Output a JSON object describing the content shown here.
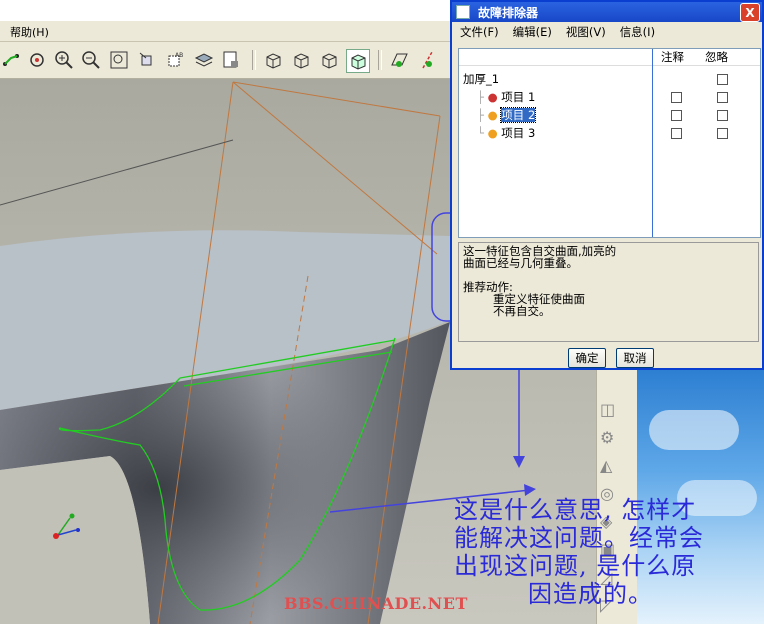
{
  "menubar": {
    "help_label": "帮助(H)"
  },
  "dialog": {
    "title": "故障排除器",
    "close_label": "X",
    "menu": [
      "文件(F)",
      "编辑(E)",
      "视图(V)",
      "信息(I)"
    ],
    "columns": {
      "note": "注释",
      "ignore": "忽略"
    },
    "tree": {
      "root": "加厚_1",
      "items": [
        "项目 1",
        "项目 2",
        "项目 3"
      ]
    },
    "message": {
      "line1": "这一特征包含自交曲面,加亮的",
      "line2": "曲面已经与几何重叠。",
      "action_title": "推荐动作:",
      "action_line1": "重定义特征使曲面",
      "action_line2": "不再自交。"
    },
    "ok_label": "确定",
    "cancel_label": "取消"
  },
  "annotation": {
    "line1": "这是什么意思, 怎样才",
    "line2": "能解决这问题。经常会",
    "line3": "出现这问题, 是什么原",
    "line4": "因造成的。"
  },
  "watermark": "BBS.CHINADE.NET",
  "colors": {
    "title_blue": "#1847c7",
    "annotation_blue": "#2a2ad8",
    "sketch_green": "#22cc22",
    "datum_orange": "#c07840",
    "watermark_red": "#e05050"
  },
  "icons": [
    "sketch-icon",
    "spin-icon",
    "zoom-in-icon",
    "zoom-out-icon",
    "refit-icon",
    "orient-icon",
    "view-manager-icon",
    "layers-icon",
    "model-tree-icon",
    "wireframe-icon",
    "hidden-line-icon",
    "no-hidden-icon",
    "shaded-icon",
    "datum-plane-icon",
    "datum-axis-icon"
  ]
}
